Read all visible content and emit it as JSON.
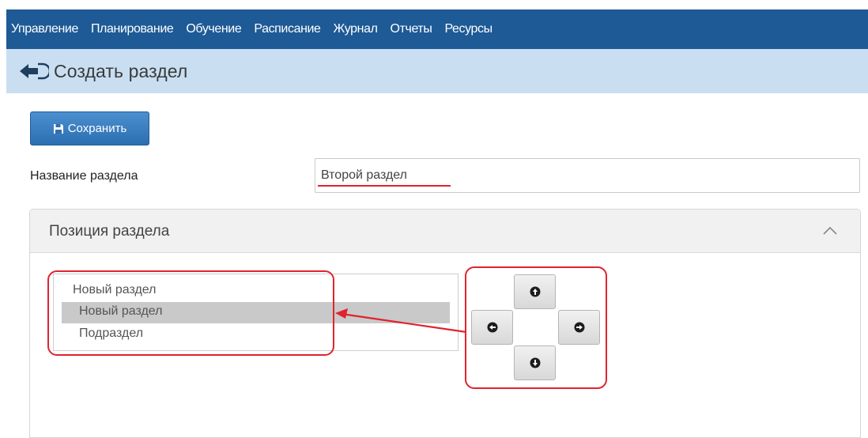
{
  "nav": {
    "items": [
      "Управление",
      "Планирование",
      "Обучение",
      "Расписание",
      "Журнал",
      "Отчеты",
      "Ресурсы"
    ]
  },
  "header": {
    "back_icon": "arrow-circle-left-icon",
    "title": "Создать раздел"
  },
  "toolbar": {
    "save_icon": "save-icon",
    "save_label": "Сохранить"
  },
  "form": {
    "name_label": "Название раздела",
    "name_value": "Второй раздел"
  },
  "position_panel": {
    "title": "Позиция раздела",
    "collapse_icon": "chevron-up-icon",
    "tree": [
      {
        "label": "Новый раздел",
        "level": 0,
        "selected": false
      },
      {
        "label": "Новый раздел",
        "level": 1,
        "selected": true
      },
      {
        "label": "Подраздел",
        "level": 1,
        "selected": false
      }
    ],
    "move_buttons": {
      "up_icon": "arrow-up-icon",
      "left_icon": "arrow-left-icon",
      "right_icon": "arrow-right-icon",
      "down_icon": "arrow-down-icon"
    }
  },
  "colors": {
    "nav_bg": "#1d5a96",
    "title_bg": "#c9dff1",
    "primary_button": "#2c6fb1",
    "annotation": "#e0232e",
    "selected_row": "#c9c9c9"
  }
}
